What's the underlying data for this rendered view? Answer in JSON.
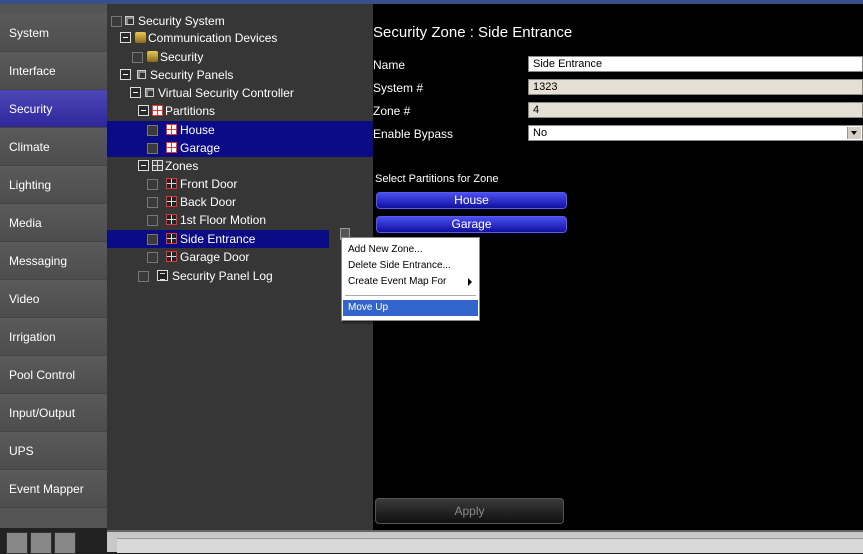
{
  "nav": {
    "items": [
      {
        "label": "System"
      },
      {
        "label": "Interface"
      },
      {
        "label": "Security",
        "active": true
      },
      {
        "label": "Climate"
      },
      {
        "label": "Lighting"
      },
      {
        "label": "Media"
      },
      {
        "label": "Messaging"
      },
      {
        "label": "Video"
      },
      {
        "label": "Irrigation"
      },
      {
        "label": "Pool Control"
      },
      {
        "label": "Input/Output"
      },
      {
        "label": "UPS"
      },
      {
        "label": "Event Mapper"
      }
    ]
  },
  "tree": {
    "security_system": "Security System",
    "communication_devices": "Communication Devices",
    "security": "Security",
    "security_panels": "Security Panels",
    "virtual_security_controller": "Virtual Security Controller",
    "partitions": "Partitions",
    "house": "House",
    "garage": "Garage",
    "zones": "Zones",
    "front_door": "Front Door",
    "back_door": "Back Door",
    "first_floor_motion": "1st Floor Motion",
    "side_entrance": "Side Entrance",
    "garage_door": "Garage Door",
    "security_panel_log": "Security Panel Log"
  },
  "panel": {
    "title": "Security Zone : Side Entrance",
    "name_label": "Name",
    "name_value": "Side Entrance",
    "system_label": "System #",
    "system_value": "1323",
    "zone_label": "Zone #",
    "zone_value": "4",
    "bypass_label": "Enable Bypass",
    "bypass_value": "No",
    "partitions_label": "Select Partitions for Zone",
    "partition_buttons": [
      "House",
      "Garage"
    ],
    "apply_label": "Apply"
  },
  "context_menu": {
    "add_new_zone": "Add New Zone...",
    "delete_item": "Delete Side Entrance...",
    "create_event_map": "Create Event Map For",
    "move_up": "Move Up"
  },
  "colors": {
    "nav_active": "#2d279a",
    "selection": "#0b0b86",
    "partition_button": "#2020c0",
    "menu_highlight": "#3366cc"
  }
}
